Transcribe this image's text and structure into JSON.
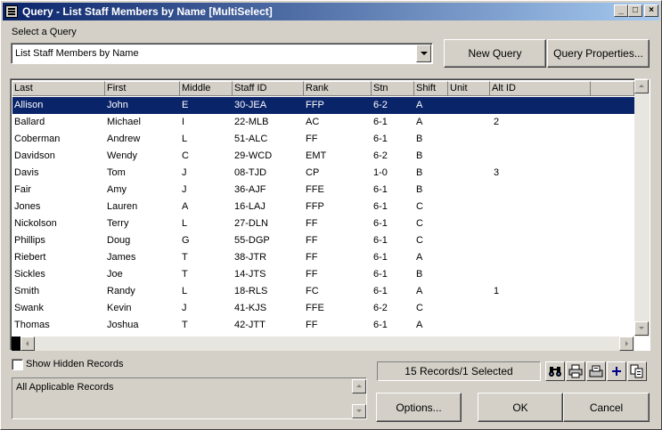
{
  "window": {
    "title": "Query - List Staff Members by Name  [MultiSelect]",
    "icon": "app-menu-icon",
    "controls": [
      "_",
      "□",
      "×"
    ]
  },
  "query_select": {
    "label": "Select a Query",
    "selected": "List Staff Members by Name"
  },
  "buttons": {
    "new_query": "New Query",
    "query_properties": "Query Properties...",
    "options": "Options...",
    "ok": "OK",
    "cancel": "Cancel"
  },
  "table": {
    "columns": [
      "Last",
      "First",
      "Middle",
      "Staff ID",
      "Rank",
      "Stn",
      "Shift",
      "Unit",
      "Alt ID"
    ],
    "rows": [
      [
        "Allison",
        "John",
        "E",
        "30-JEA",
        "FFP",
        "6-2",
        "A",
        "",
        ""
      ],
      [
        "Ballard",
        "Michael",
        "I",
        "22-MLB",
        "AC",
        "6-1",
        "A",
        "",
        "2"
      ],
      [
        "Coberman",
        "Andrew",
        "L",
        "51-ALC",
        "FF",
        "6-1",
        "B",
        "",
        ""
      ],
      [
        "Davidson",
        "Wendy",
        "C",
        "29-WCD",
        "EMT",
        "6-2",
        "B",
        "",
        ""
      ],
      [
        "Davis",
        "Tom",
        "J",
        "08-TJD",
        "CP",
        "1-0",
        "B",
        "",
        "3"
      ],
      [
        "Fair",
        "Amy",
        "J",
        "36-AJF",
        "FFE",
        "6-1",
        "B",
        "",
        ""
      ],
      [
        "Jones",
        "Lauren",
        "A",
        "16-LAJ",
        "FFP",
        "6-1",
        "C",
        "",
        ""
      ],
      [
        "Nickolson",
        "Terry",
        "L",
        "27-DLN",
        "FF",
        "6-1",
        "C",
        "",
        ""
      ],
      [
        "Phillips",
        "Doug",
        "G",
        "55-DGP",
        "FF",
        "6-1",
        "C",
        "",
        ""
      ],
      [
        "Riebert",
        "James",
        "T",
        "38-JTR",
        "FF",
        "6-1",
        "A",
        "",
        ""
      ],
      [
        "Sickles",
        "Joe",
        "T",
        "14-JTS",
        "FF",
        "6-1",
        "B",
        "",
        ""
      ],
      [
        "Smith",
        "Randy",
        "L",
        "18-RLS",
        "FC",
        "6-1",
        "A",
        "",
        "1"
      ],
      [
        "Swank",
        "Kevin",
        "J",
        "41-KJS",
        "FFE",
        "6-2",
        "C",
        "",
        ""
      ],
      [
        "Thomas",
        "Joshua",
        "T",
        "42-JTT",
        "FF",
        "6-1",
        "A",
        "",
        ""
      ]
    ],
    "selected_row_index": 0
  },
  "show_hidden": {
    "label": "Show Hidden Records",
    "checked": false
  },
  "description": "All Applicable Records",
  "status": "15 Records/1 Selected",
  "toolbar_icons": [
    "binoculars-icon",
    "printer-icon",
    "export-icon",
    "add-icon",
    "copy-icon"
  ],
  "colors": {
    "selection": "#0a246a",
    "titlebar_start": "#0a246a",
    "titlebar_end": "#a6caf0",
    "face": "#d4d0c8"
  }
}
